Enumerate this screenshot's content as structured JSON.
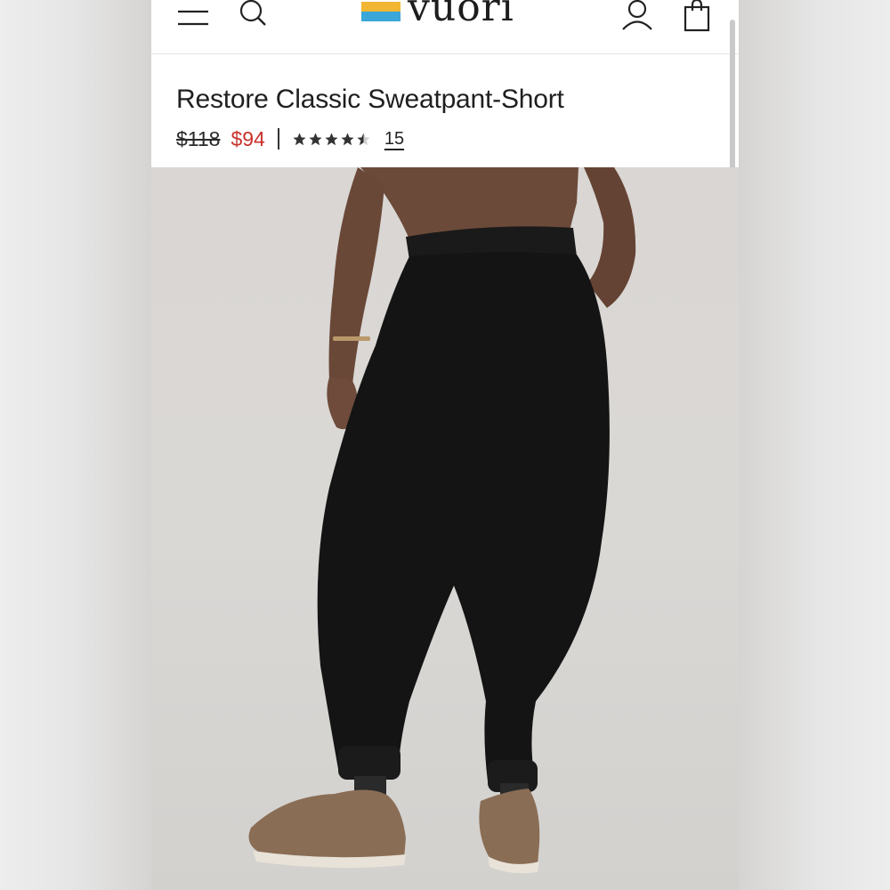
{
  "header": {
    "menu_icon": "hamburger-menu-icon",
    "search_icon": "search-icon",
    "logo_text": "vuori",
    "account_icon": "user-account-icon",
    "bag_icon": "shopping-bag-icon",
    "logo_colors": [
      "#f2b632",
      "#3aa7d8"
    ]
  },
  "product": {
    "title": "Restore Classic Sweatpant-Short",
    "original_price": "$118",
    "sale_price": "$94",
    "rating": 4.5,
    "rating_max": 5,
    "review_count": "15",
    "sale_color": "#c8312b"
  },
  "image": {
    "description_icon": "product-photo"
  }
}
